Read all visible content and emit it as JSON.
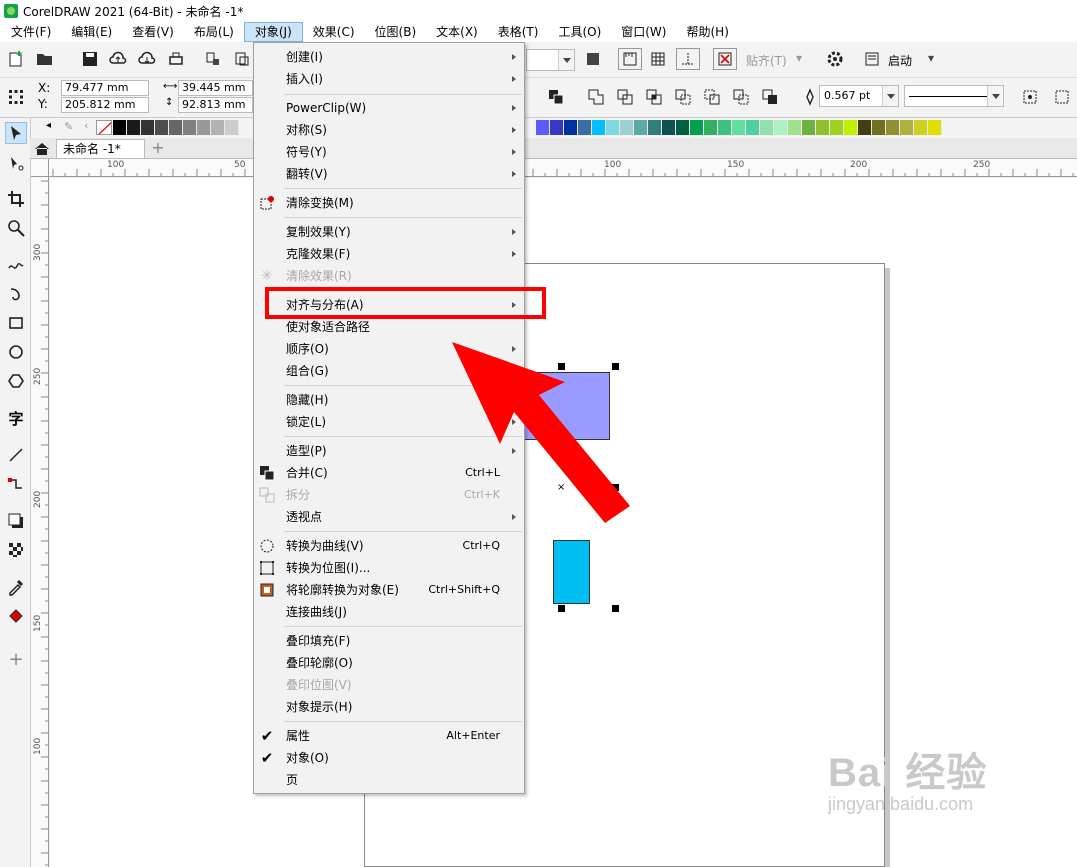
{
  "window": {
    "title": "CorelDRAW 2021 (64-Bit) - 未命名 -1*"
  },
  "menubar": {
    "items": [
      {
        "label": "文件(F)"
      },
      {
        "label": "编辑(E)"
      },
      {
        "label": "查看(V)"
      },
      {
        "label": "布局(L)"
      },
      {
        "label": "对象(J)",
        "active": true
      },
      {
        "label": "效果(C)"
      },
      {
        "label": "位图(B)"
      },
      {
        "label": "文本(X)"
      },
      {
        "label": "表格(T)"
      },
      {
        "label": "工具(O)"
      },
      {
        "label": "窗口(W)"
      },
      {
        "label": "帮助(H)"
      }
    ]
  },
  "toolbar": {
    "snap_label": "贴齐(T)",
    "launch_label": "启动"
  },
  "property_bar": {
    "x_label": "X:",
    "y_label": "Y:",
    "x_value": "79.477 mm",
    "y_value": "205.812 mm",
    "width_value": "39.445 mm",
    "height_value": "92.813 mm",
    "outline_width": "0.567 pt"
  },
  "document_tab": {
    "label": "未命名 -1*"
  },
  "rulers": {
    "horizontal": [
      "100",
      "50",
      "100",
      "150",
      "200",
      "250"
    ],
    "vertical": [
      "300",
      "250",
      "200",
      "150",
      "100"
    ]
  },
  "palette": {
    "colors": [
      "#000000",
      "#1a1a1a",
      "#333333",
      "#4d4d4d",
      "#666666",
      "#808080",
      "#999999",
      "#b3b3b3",
      "#cccccc",
      "#5b5bff",
      "#3838c8",
      "#0030a0",
      "#3a6ea5",
      "#00c0ff",
      "#7fd8e0",
      "#9fd0d0",
      "#5fa8a8",
      "#2f7f7f",
      "#0f5050",
      "#006040",
      "#00a050",
      "#30b060",
      "#40c080",
      "#60e0a0",
      "#50d0a0",
      "#90e0b0",
      "#b0f0c0",
      "#a0e090",
      "#70b040",
      "#90c030",
      "#a0d020",
      "#c0f000",
      "#404010",
      "#707020",
      "#909030",
      "#b0b040",
      "#d0d020",
      "#e0e000"
    ]
  },
  "context_menu": {
    "items": [
      {
        "label": "创建(I)",
        "submenu": true
      },
      {
        "label": "插入(I)",
        "submenu": true
      },
      {
        "label": "PowerClip(W)",
        "submenu": true
      },
      {
        "label": "对称(S)",
        "submenu": true
      },
      {
        "label": "符号(Y)",
        "submenu": true
      },
      {
        "label": "翻转(V)",
        "submenu": true
      },
      {
        "label": "清除变换(M)"
      },
      {
        "label": "复制效果(Y)",
        "submenu": true
      },
      {
        "label": "克隆效果(F)",
        "submenu": true
      },
      {
        "label": "清除效果(R)",
        "disabled": true
      },
      {
        "label": "对齐与分布(A)",
        "submenu": true,
        "highlighted": true
      },
      {
        "label": "使对象适合路径"
      },
      {
        "label": "顺序(O)",
        "submenu": true
      },
      {
        "label": "组合(G)",
        "submenu": true
      },
      {
        "label": "隐藏(H)",
        "submenu": true
      },
      {
        "label": "锁定(L)",
        "submenu": true
      },
      {
        "label": "造型(P)",
        "submenu": true
      },
      {
        "label": "合并(C)",
        "shortcut": "Ctrl+L"
      },
      {
        "label": "拆分",
        "shortcut": "Ctrl+K",
        "disabled": true
      },
      {
        "label": "透视点",
        "submenu": true
      },
      {
        "label": "转换为曲线(V)",
        "shortcut": "Ctrl+Q"
      },
      {
        "label": "转换为位图(I)..."
      },
      {
        "label": "将轮廓转换为对象(E)",
        "shortcut": "Ctrl+Shift+Q"
      },
      {
        "label": "连接曲线(J)"
      },
      {
        "label": "叠印填充(F)"
      },
      {
        "label": "叠印轮廓(O)"
      },
      {
        "label": "叠印位图(V)",
        "disabled": true
      },
      {
        "label": "对象提示(H)"
      },
      {
        "label": "属性",
        "shortcut": "Alt+Enter",
        "checked": true
      },
      {
        "label": "对象(O)",
        "checked": true
      },
      {
        "label": "页"
      }
    ]
  },
  "canvas": {
    "purple_fill": "#9b9bff",
    "cyan_fill": "#00bff3"
  },
  "annotation": {
    "highlight_color": "#ff0000",
    "arrow_color": "#ff0000"
  },
  "watermark": {
    "main": "Bai 经验",
    "sub": "jingyan.baidu.com"
  }
}
